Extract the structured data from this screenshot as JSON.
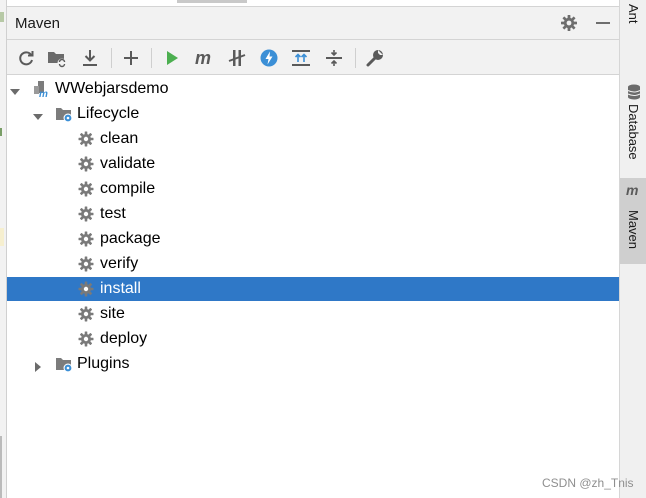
{
  "panel": {
    "title": "Maven"
  },
  "toolbar": {
    "buttons": [
      {
        "icon": "reload-icon"
      },
      {
        "icon": "add-folder-icon"
      },
      {
        "icon": "download-icon"
      },
      {
        "icon": "plus-icon"
      },
      {
        "icon": "run-icon"
      },
      {
        "icon": "maven-m-icon"
      },
      {
        "icon": "skip-tests-icon"
      },
      {
        "icon": "offline-icon"
      },
      {
        "icon": "expand-all-icon"
      },
      {
        "icon": "collapse-all-icon"
      },
      {
        "icon": "settings-wrench-icon"
      }
    ]
  },
  "tree": {
    "project": "WWebjarsdemo",
    "lifecycle_label": "Lifecycle",
    "phases": [
      "clean",
      "validate",
      "compile",
      "test",
      "package",
      "verify",
      "install",
      "site",
      "deploy"
    ],
    "selected_phase": "install",
    "plugins_label": "Plugins"
  },
  "side_strip": {
    "tabs": [
      "Ant",
      "Database",
      "Maven"
    ],
    "active": "Maven"
  },
  "watermark": "CSDN @zh_Tnis",
  "colors": {
    "selection": "#2f78c7",
    "run_green": "#4caf50",
    "accent_blue": "#3b8fd6",
    "gear_gray": "#7a7a7a"
  }
}
